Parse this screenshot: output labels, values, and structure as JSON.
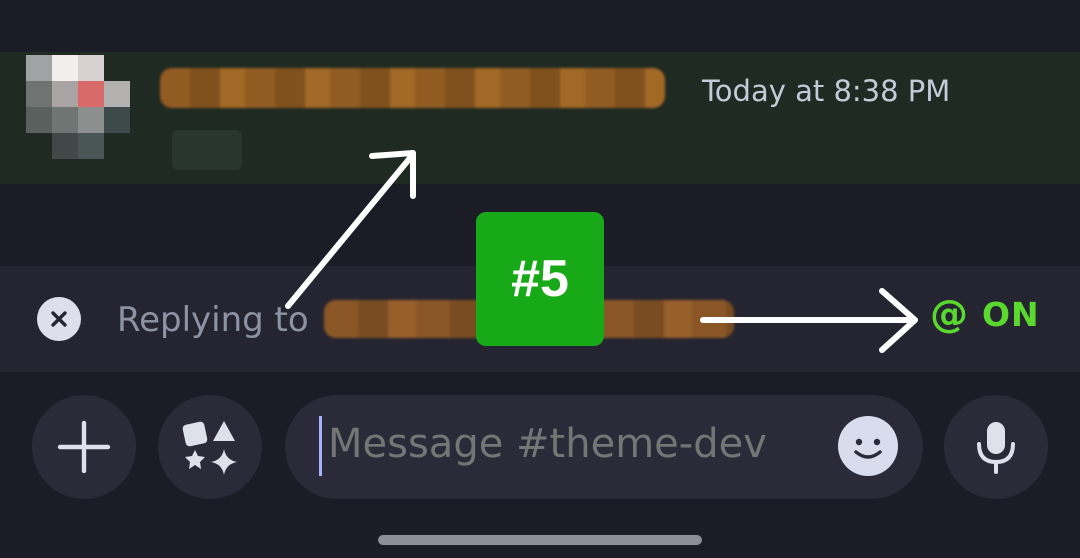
{
  "message": {
    "timestamp": "Today at 8:38 PM"
  },
  "reply_bar": {
    "label": "Replying to",
    "mention_symbol": "@",
    "mention_state": "ON"
  },
  "annotation": {
    "badge": "#5"
  },
  "composer": {
    "placeholder": "Message #theme-dev"
  },
  "colors": {
    "background": "#1c1c27",
    "highlight_band": "#1f2a22",
    "mention_on": "#5bd82e",
    "badge": "#18a918"
  },
  "icons": {
    "add": "plus-icon",
    "apps": "apps-icon",
    "emoji": "emoji-icon",
    "voice": "microphone-icon",
    "cancel_reply": "close-icon"
  }
}
